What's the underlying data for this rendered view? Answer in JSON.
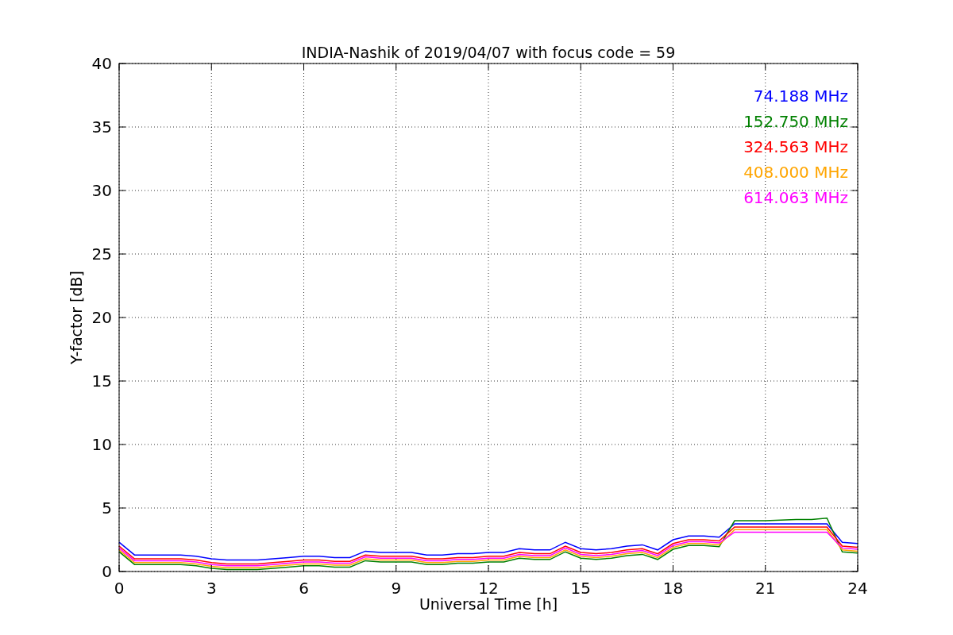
{
  "figure": {
    "chart_data": {
      "type": "line",
      "title": "INDIA-Nashik of 2019/04/07 with focus code = 59",
      "xlabel": "Universal Time [h]",
      "ylabel": "Y-factor [dB]",
      "x": [
        0,
        0.5,
        1,
        1.5,
        2,
        2.5,
        3,
        3.5,
        4,
        4.5,
        5,
        5.5,
        6,
        6.5,
        7,
        7.5,
        8,
        8.5,
        9,
        9.5,
        10,
        10.5,
        11,
        11.5,
        12,
        12.5,
        13,
        13.5,
        14,
        14.5,
        15,
        15.5,
        16,
        16.5,
        17,
        17.5,
        18,
        18.5,
        19,
        19.5,
        20,
        20.5,
        21,
        21.5,
        22,
        22.5,
        23,
        23.5,
        24
      ],
      "series": [
        {
          "name": "74.188 MHz",
          "color": "#0000ff",
          "values": [
            2.3,
            1.3,
            1.3,
            1.3,
            1.3,
            1.2,
            1.0,
            0.9,
            0.9,
            0.9,
            1.0,
            1.1,
            1.2,
            1.2,
            1.1,
            1.1,
            1.6,
            1.5,
            1.5,
            1.5,
            1.3,
            1.3,
            1.4,
            1.4,
            1.5,
            1.5,
            1.8,
            1.7,
            1.7,
            2.3,
            1.8,
            1.7,
            1.8,
            2.0,
            2.1,
            1.7,
            2.5,
            2.8,
            2.8,
            2.7,
            3.75,
            3.75,
            3.75,
            3.75,
            3.75,
            3.75,
            3.75,
            2.3,
            2.2
          ]
        },
        {
          "name": "152.750 MHz",
          "color": "#008000",
          "values": [
            1.55,
            0.55,
            0.55,
            0.55,
            0.55,
            0.45,
            0.25,
            0.15,
            0.15,
            0.15,
            0.25,
            0.35,
            0.45,
            0.45,
            0.35,
            0.35,
            0.85,
            0.75,
            0.75,
            0.75,
            0.55,
            0.55,
            0.65,
            0.65,
            0.75,
            0.75,
            1.05,
            0.95,
            0.95,
            1.55,
            1.05,
            0.95,
            1.05,
            1.25,
            1.35,
            0.95,
            1.75,
            2.05,
            2.05,
            1.95,
            4.0,
            4.0,
            4.0,
            4.05,
            4.1,
            4.1,
            4.2,
            1.55,
            1.45
          ]
        },
        {
          "name": "324.563 MHz",
          "color": "#ff0000",
          "values": [
            2.0,
            1.0,
            1.0,
            1.0,
            1.0,
            0.9,
            0.7,
            0.6,
            0.6,
            0.6,
            0.7,
            0.8,
            0.9,
            0.9,
            0.8,
            0.8,
            1.3,
            1.2,
            1.2,
            1.2,
            1.0,
            1.0,
            1.1,
            1.1,
            1.2,
            1.2,
            1.5,
            1.4,
            1.4,
            2.0,
            1.5,
            1.4,
            1.5,
            1.7,
            1.8,
            1.4,
            2.2,
            2.5,
            2.5,
            2.4,
            3.5,
            3.5,
            3.5,
            3.5,
            3.5,
            3.5,
            3.5,
            2.0,
            1.9
          ]
        },
        {
          "name": "408.000 MHz",
          "color": "#ffa500",
          "values": [
            1.7,
            0.7,
            0.7,
            0.7,
            0.7,
            0.6,
            0.4,
            0.3,
            0.3,
            0.3,
            0.4,
            0.5,
            0.6,
            0.6,
            0.5,
            0.5,
            1.0,
            0.9,
            0.9,
            0.9,
            0.7,
            0.7,
            0.8,
            0.8,
            0.9,
            0.9,
            1.2,
            1.1,
            1.1,
            1.7,
            1.2,
            1.1,
            1.2,
            1.4,
            1.5,
            1.1,
            1.9,
            2.2,
            2.2,
            2.1,
            3.3,
            3.3,
            3.3,
            3.3,
            3.3,
            3.3,
            3.3,
            1.7,
            1.6
          ]
        },
        {
          "name": "614.063 MHz",
          "color": "#ff00ff",
          "values": [
            1.85,
            0.85,
            0.85,
            0.85,
            0.85,
            0.75,
            0.55,
            0.45,
            0.45,
            0.45,
            0.55,
            0.65,
            0.75,
            0.75,
            0.65,
            0.65,
            1.15,
            1.05,
            1.05,
            1.05,
            0.85,
            0.85,
            0.95,
            0.95,
            1.05,
            1.05,
            1.35,
            1.25,
            1.25,
            1.85,
            1.35,
            1.25,
            1.35,
            1.55,
            1.65,
            1.25,
            2.05,
            2.35,
            2.35,
            2.25,
            3.1,
            3.1,
            3.1,
            3.1,
            3.1,
            3.1,
            3.1,
            1.85,
            1.75
          ]
        }
      ],
      "xlim": [
        0,
        24
      ],
      "ylim": [
        0,
        40
      ],
      "xticks": [
        0,
        3,
        6,
        9,
        12,
        15,
        18,
        21,
        24
      ],
      "yticks": [
        0,
        5,
        10,
        15,
        20,
        25,
        30,
        35,
        40
      ],
      "grid": true
    }
  }
}
